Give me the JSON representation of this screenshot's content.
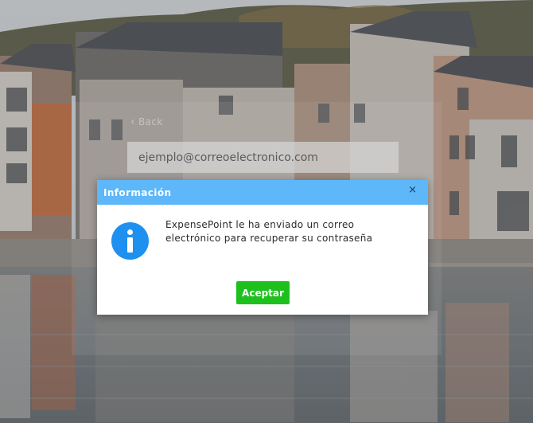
{
  "form": {
    "back_label": "Back",
    "email_placeholder": "ejemplo@correoelectronico.com"
  },
  "modal": {
    "title": "Información",
    "close_symbol": "×",
    "icon": "info-icon",
    "message_line1": "ExpensePoint le ha enviado un correo",
    "message_line2": "electrónico para recuperar su contraseña",
    "accept_label": "Aceptar"
  },
  "colors": {
    "modal_header": "#5db7f8",
    "info_icon": "#1e90f0",
    "accept_button": "#1ec01e"
  }
}
